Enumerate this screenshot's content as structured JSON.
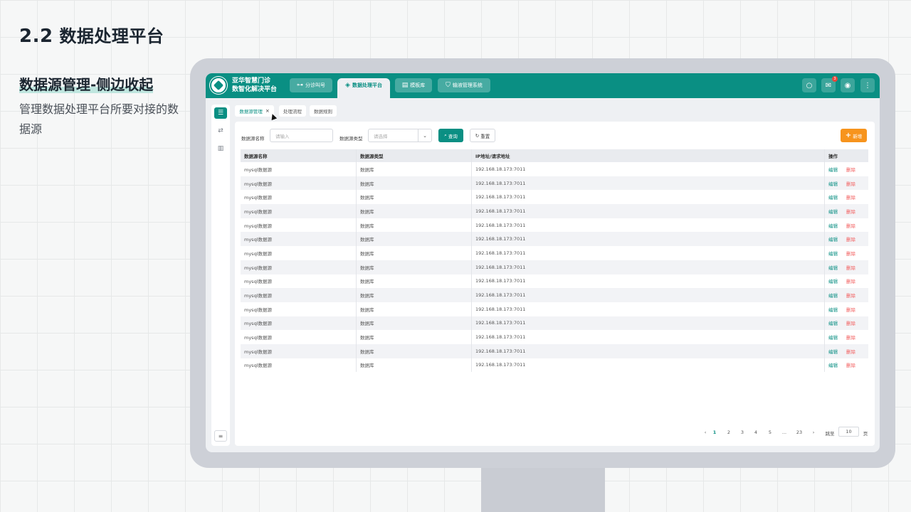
{
  "slide": {
    "title_num": "2.2",
    "title_text": "数据处理平台",
    "section_heading": "数据源管理-侧边收起",
    "section_desc": "管理数据处理平台所要对接的数据源"
  },
  "app": {
    "brand_line1": "亚华智慧门诊",
    "brand_line2": "数智化解决平台",
    "nav": [
      {
        "label": "分诊叫号",
        "icon": "sitemap-icon"
      },
      {
        "label": "数据处理平台",
        "icon": "layers-icon",
        "active": true
      },
      {
        "label": "模板库",
        "icon": "template-icon"
      },
      {
        "label": "输液管理系统",
        "icon": "shield-icon"
      }
    ],
    "notification_count": "3"
  },
  "tabs": [
    {
      "label": "数据源管理",
      "active": true,
      "close": "×"
    },
    {
      "label": "处理流程"
    },
    {
      "label": "数据规则"
    }
  ],
  "filters": {
    "name_label": "数据源名称",
    "name_placeholder": "请输入",
    "type_label": "数据源类型",
    "type_placeholder": "请选择",
    "query_label": "查询",
    "reset_label": "重置",
    "add_label": "新增"
  },
  "table": {
    "headers": [
      "数据源名称",
      "数据源类型",
      "IP地址/请求地址",
      "操作"
    ],
    "rows": [
      {
        "name": "mysql数据源",
        "type": "数据库",
        "ip": "192.168.18.173:7011"
      },
      {
        "name": "mysql数据源",
        "type": "数据库",
        "ip": "192.168.18.173:7011"
      },
      {
        "name": "mysql数据源",
        "type": "数据库",
        "ip": "192.168.18.173:7011"
      },
      {
        "name": "mysql数据源",
        "type": "数据库",
        "ip": "192.168.18.173:7011"
      },
      {
        "name": "mysql数据源",
        "type": "数据库",
        "ip": "192.168.18.173:7011"
      },
      {
        "name": "mysql数据源",
        "type": "数据库",
        "ip": "192.168.18.173:7011"
      },
      {
        "name": "mysql数据源",
        "type": "数据库",
        "ip": "192.168.18.173:7011"
      },
      {
        "name": "mysql数据源",
        "type": "数据库",
        "ip": "192.168.18.173:7011"
      },
      {
        "name": "mysql数据源",
        "type": "数据库",
        "ip": "192.168.18.173:7011"
      },
      {
        "name": "mysql数据源",
        "type": "数据库",
        "ip": "192.168.18.173:7011"
      },
      {
        "name": "mysql数据源",
        "type": "数据库",
        "ip": "192.168.18.173:7011"
      },
      {
        "name": "mysql数据源",
        "type": "数据库",
        "ip": "192.168.18.173:7011"
      },
      {
        "name": "mysql数据源",
        "type": "数据库",
        "ip": "192.168.18.173:7011"
      },
      {
        "name": "mysql数据源",
        "type": "数据库",
        "ip": "192.168.18.173:7011"
      },
      {
        "name": "mysql数据源",
        "type": "数据库",
        "ip": "192.168.18.173:7011"
      }
    ],
    "edit_label": "编辑",
    "delete_label": "删除"
  },
  "pagination": {
    "prev": "‹",
    "pages": [
      "1",
      "2",
      "3",
      "4",
      "5"
    ],
    "ellipsis": "...",
    "last": "23",
    "next": "›",
    "jump_label": "跳至",
    "jump_value": "10",
    "page_suffix": "页"
  }
}
